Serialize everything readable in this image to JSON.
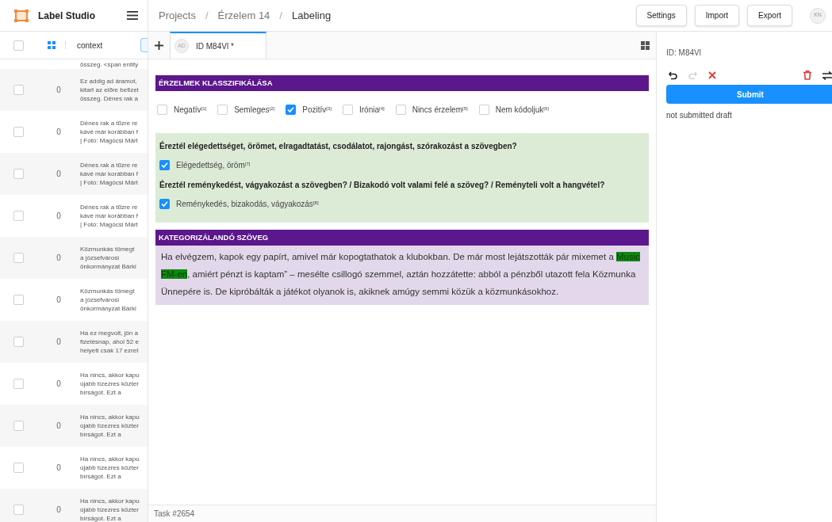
{
  "app": {
    "name": "Label Studio"
  },
  "breadcrumb": [
    "Projects",
    "Érzelem 14",
    "Labeling"
  ],
  "breadcrumb_separator": "/",
  "header_buttons": [
    "Settings",
    "Import",
    "Export"
  ],
  "user_avatar": "KN",
  "task_table": {
    "all_selected": false,
    "column": "context",
    "top_cut_text": "összeg. <span entity",
    "rows": [
      {
        "lines": [
          "Ez addig ad áramot,",
          "kitart az előre befizet",
          "összeg. Dénes rak a"
        ],
        "value": "0",
        "checked": false
      },
      {
        "lines": [
          "Dénes rak a tűzre re",
          "kávé már korábban f",
          "| Fotó: Magócsi Márt"
        ],
        "value": "0",
        "checked": false
      },
      {
        "lines": [
          "Dénes rak a tűzre re",
          "kávé már korábban f",
          "| Fotó: Magócsi Márt"
        ],
        "value": "0",
        "checked": false
      },
      {
        "lines": [
          "Dénes rak a tűzre re",
          "kávé már korábban f",
          "| Fotó: Magócsi Márt"
        ],
        "value": "0",
        "checked": false
      },
      {
        "lines": [
          "Közmunkás tömegt",
          "a józsefvárosi",
          "önkormányzat Bárki"
        ],
        "value": "0",
        "checked": false
      },
      {
        "lines": [
          "Közmunkás tömegt",
          "a józsefvárosi",
          "önkormányzat Bárki"
        ],
        "value": "0",
        "checked": false
      },
      {
        "lines": [
          "Ha ez megvolt, jön a",
          "fizetésnap, ahol 52 e",
          "helyett csak 17 ezret"
        ],
        "value": "0",
        "checked": false
      },
      {
        "lines": [
          "Ha nincs, akkor kapu",
          "újabb tízezres közter",
          "bírságot. Ezt a"
        ],
        "value": "0",
        "checked": false
      },
      {
        "lines": [
          "Ha nincs, akkor kapu",
          "újabb tízezres közter",
          "bírságot. Ezt a"
        ],
        "value": "0",
        "checked": false
      },
      {
        "lines": [
          "Ha nincs, akkor kapu",
          "újabb tízezres közter",
          "bírságot. Ezt a"
        ],
        "value": "0",
        "checked": false
      },
      {
        "lines": [
          "Ha nincs, akkor kapu",
          "újabb tízezres közter",
          "bírságot. Ezt a"
        ],
        "value": "0",
        "checked": false
      }
    ]
  },
  "tabs": [
    {
      "avatar": "AD",
      "label": "ID M84Vl *",
      "selected": true
    }
  ],
  "sections": [
    {
      "kind": "choices",
      "title": "ÉRZELMEK KLASSZIFIKÁLÁSA",
      "choices": [
        {
          "label": "Negatív$^{[1]}$",
          "checked": false
        },
        {
          "label": "Semleges$^{[2]}$",
          "checked": false
        },
        {
          "label": "Pozitív$^{[3]}$",
          "checked": true
        },
        {
          "label": "Irónia$^{[4]}$",
          "checked": false
        },
        {
          "label": "Nincs érzelem$^{[5]}$",
          "checked": false
        },
        {
          "label": "Nem kódoljuk$^{[6]}$",
          "checked": false
        }
      ]
    },
    {
      "kind": "questions",
      "items": [
        {
          "question": "Éreztél elégedettséget, örömet, elragadtatást, csodálatot, rajongást, szórakozást a szövegben?",
          "choices": [
            {
              "label": "Elégedettség, öröm$^{[7]}$",
              "checked": true
            }
          ]
        },
        {
          "question": "Éreztél reménykedést, vágyakozást a szövegben? / Bizakodó volt valami felé a szöveg? / Reményteli volt a hangvétel?",
          "choices": [
            {
              "label": "Reménykedés, bizakodás, vágyakozás$^{[8]}$",
              "checked": true
            }
          ]
        }
      ]
    },
    {
      "kind": "text",
      "title": "KATEGORIZÁLANDÓ SZÖVEG",
      "segments": [
        {
          "text": "Ha elvégzem, kapok egy papírt, amivel már kopogtathatok a klubokban. De már most lejátszották pár mixemet a ",
          "highlighted": false
        },
        {
          "text": "Music FM-en",
          "highlighted": true
        },
        {
          "text": ", amiért pénzt is kaptam” – mesélte csillogó szemmel, aztán hozzátette: abból a pénzből utazott fela Közmunka Ünnepére is. De kipróbálták a játékot olyanok is, akiknek amúgy semmi közük a közmunkásokhoz.",
          "highlighted": false
        }
      ]
    }
  ],
  "footer": "Task #2654",
  "side_panel": {
    "id": "ID: M84Vl",
    "redo_disabled": true,
    "submit": "Submit",
    "status": "not submitted draft"
  }
}
